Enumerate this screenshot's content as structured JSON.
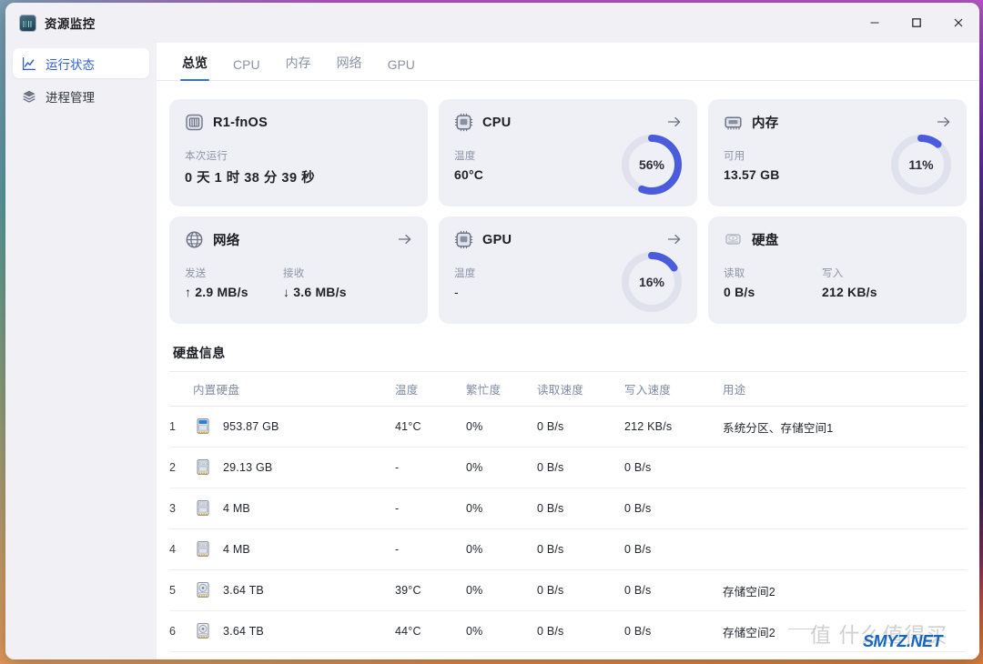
{
  "window": {
    "title": "资源监控",
    "app_icon": "chart-app-icon",
    "controls": {
      "minimize": "–",
      "maximize": "☐",
      "close": "✕"
    }
  },
  "sidebar": {
    "items": [
      {
        "label": "运行状态",
        "icon": "line-chart-icon",
        "active": true
      },
      {
        "label": "进程管理",
        "icon": "layers-icon",
        "active": false
      }
    ]
  },
  "tabs": [
    {
      "label": "总览",
      "active": true
    },
    {
      "label": "CPU",
      "active": false
    },
    {
      "label": "内存",
      "active": false
    },
    {
      "label": "网络",
      "active": false
    },
    {
      "label": "GPU",
      "active": false
    }
  ],
  "cards": {
    "host": {
      "title": "R1-fnOS",
      "icon": "server-rack-icon",
      "metric_label": "本次运行",
      "uptime": "0 天 1 时 38 分 39 秒",
      "has_arrow": false
    },
    "cpu": {
      "title": "CPU",
      "icon": "cpu-chip-icon",
      "metric_label": "温度",
      "metric_value": "60°C",
      "gauge_percent": 56,
      "gauge_text": "56%",
      "has_arrow": true
    },
    "memory": {
      "title": "内存",
      "icon": "ram-chip-icon",
      "metric_label": "可用",
      "metric_value": "13.57 GB",
      "gauge_percent": 11,
      "gauge_text": "11%",
      "has_arrow": true
    },
    "network": {
      "title": "网络",
      "icon": "globe-icon",
      "send_label": "发送",
      "send_value": "↑ 2.9 MB/s",
      "recv_label": "接收",
      "recv_value": "↓ 3.6 MB/s",
      "has_arrow": true
    },
    "gpu": {
      "title": "GPU",
      "icon": "gpu-chip-icon",
      "metric_label": "温度",
      "metric_value": "-",
      "gauge_percent": 16,
      "gauge_text": "16%",
      "has_arrow": true
    },
    "disk": {
      "title": "硬盘",
      "icon": "hard-disk-icon",
      "read_label": "读取",
      "read_value": "0 B/s",
      "write_label": "写入",
      "write_value": "212 KB/s",
      "has_arrow": false
    }
  },
  "disk_section": {
    "title": "硬盘信息",
    "columns": [
      "内置硬盘",
      "温度",
      "繁忙度",
      "读取速度",
      "写入速度",
      "用途"
    ],
    "rows": [
      {
        "index": "1",
        "icon": "ssd-system-icon",
        "capacity": "953.87 GB",
        "temp": "41°C",
        "busy": "0%",
        "read": "0 B/s",
        "write": "212 KB/s",
        "use": "系统分区、存储空间1"
      },
      {
        "index": "2",
        "icon": "ssd-icon",
        "capacity": "29.13 GB",
        "temp": "-",
        "busy": "0%",
        "read": "0 B/s",
        "write": "0 B/s",
        "use": ""
      },
      {
        "index": "3",
        "icon": "ssd-icon",
        "capacity": "4 MB",
        "temp": "-",
        "busy": "0%",
        "read": "0 B/s",
        "write": "0 B/s",
        "use": ""
      },
      {
        "index": "4",
        "icon": "ssd-icon",
        "capacity": "4 MB",
        "temp": "-",
        "busy": "0%",
        "read": "0 B/s",
        "write": "0 B/s",
        "use": ""
      },
      {
        "index": "5",
        "icon": "hdd-icon",
        "capacity": "3.64 TB",
        "temp": "39°C",
        "busy": "0%",
        "read": "0 B/s",
        "write": "0 B/s",
        "use": "存储空间2"
      },
      {
        "index": "6",
        "icon": "hdd-icon",
        "capacity": "3.64 TB",
        "temp": "44°C",
        "busy": "0%",
        "read": "0 B/s",
        "write": "0 B/s",
        "use": "存储空间2"
      }
    ]
  },
  "watermark": {
    "mark": "值 什么值得买",
    "site": "SMYZ.NET"
  },
  "colors": {
    "accent": "#4a5bdc",
    "tab_active": "#3b6fd4",
    "nav_active_text": "#2f5fd0",
    "card_bg": "#eef0f6",
    "gauge_track": "#dfe2ec",
    "watermark_blue": "#1565c0"
  }
}
